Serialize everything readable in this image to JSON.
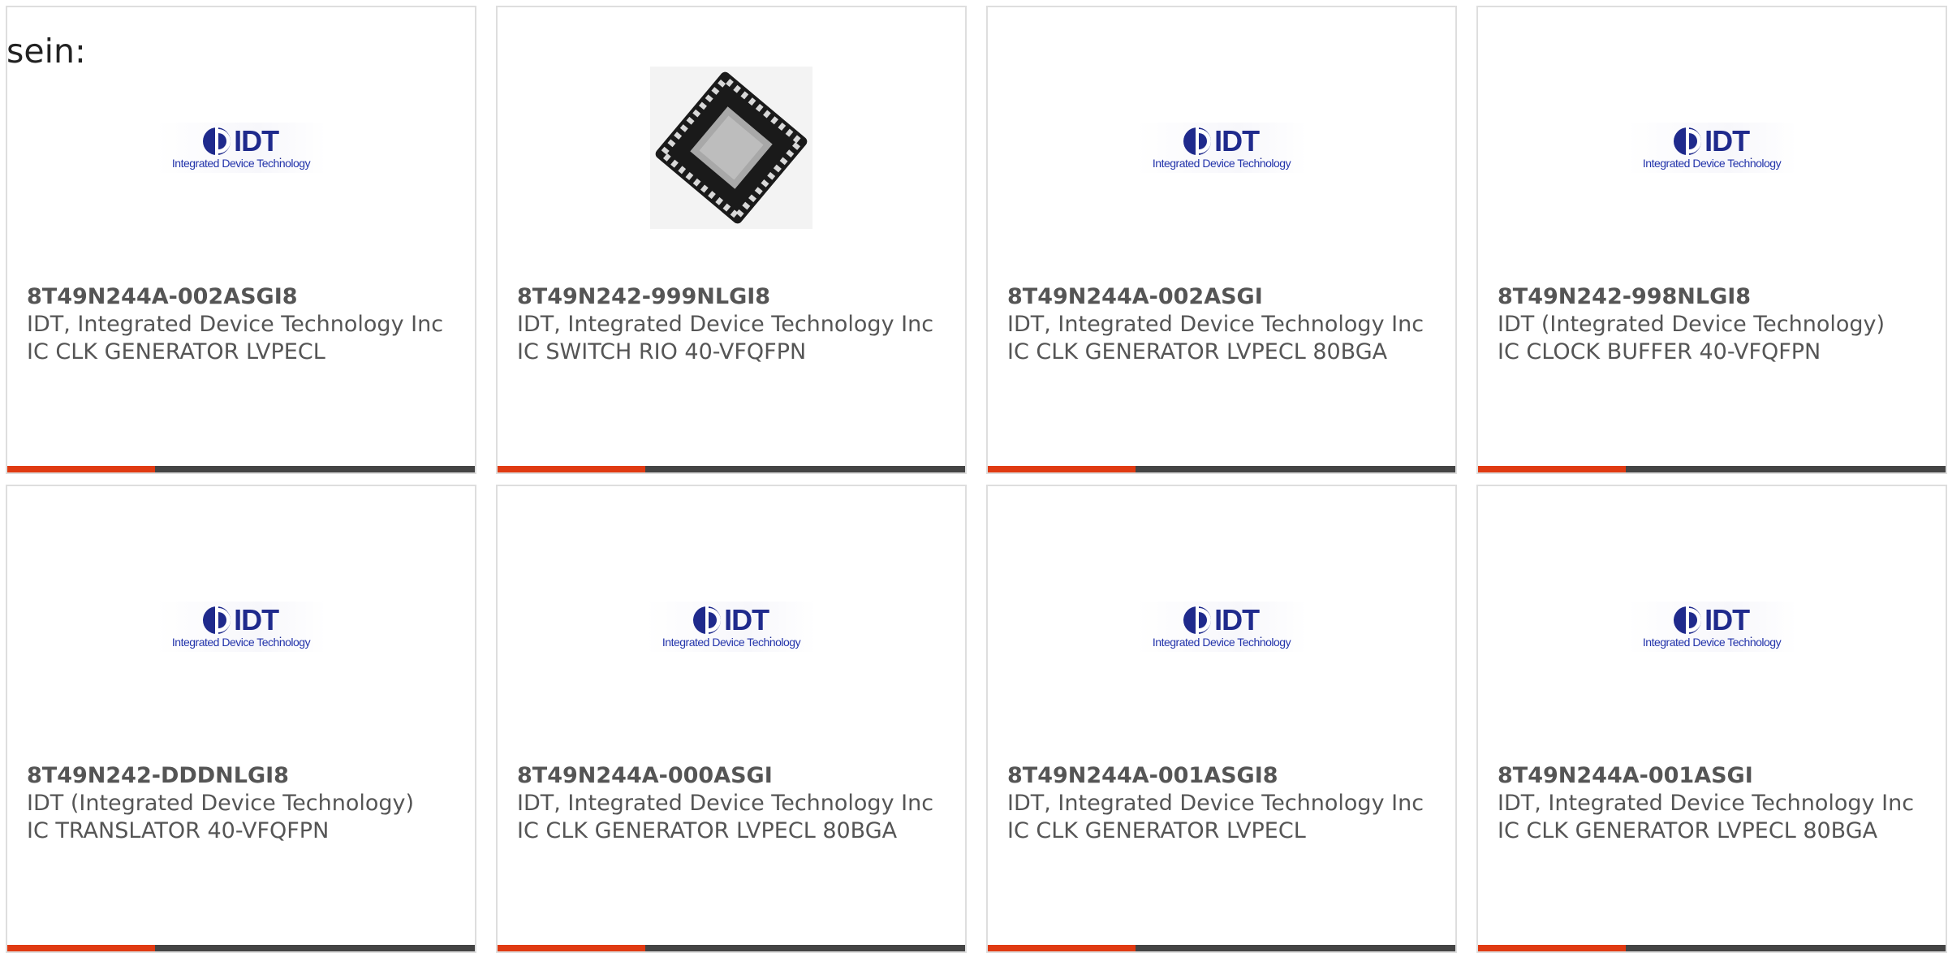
{
  "intro_text": "sein:",
  "theme": {
    "accent_color": "#e03a12",
    "bar_color": "#444444",
    "border_color": "#dedede",
    "logo_color": "#1f2a8c"
  },
  "logo": {
    "wordmark": "IDT",
    "tm": ".",
    "tagline": "Integrated Device Technology"
  },
  "products": [
    {
      "image": "idt-logo",
      "part": "8T49N244A-002ASGI8",
      "maker": "IDT, Integrated Device Technology Inc",
      "desc": "IC CLK GENERATOR LVPECL"
    },
    {
      "image": "chip-photo",
      "part": "8T49N242-999NLGI8",
      "maker": "IDT, Integrated Device Technology Inc",
      "desc": "IC SWITCH RIO 40-VFQFPN"
    },
    {
      "image": "idt-logo",
      "part": "8T49N244A-002ASGI",
      "maker": "IDT, Integrated Device Technology Inc",
      "desc": "IC CLK GENERATOR LVPECL 80BGA"
    },
    {
      "image": "idt-logo",
      "part": "8T49N242-998NLGI8",
      "maker": "IDT (Integrated Device Technology)",
      "desc": "IC CLOCK BUFFER 40-VFQFPN"
    },
    {
      "image": "idt-logo",
      "part": "8T49N242-DDDNLGI8",
      "maker": "IDT (Integrated Device Technology)",
      "desc": "IC TRANSLATOR 40-VFQFPN"
    },
    {
      "image": "idt-logo",
      "part": "8T49N244A-000ASGI",
      "maker": "IDT, Integrated Device Technology Inc",
      "desc": "IC CLK GENERATOR LVPECL 80BGA"
    },
    {
      "image": "idt-logo",
      "part": "8T49N244A-001ASGI8",
      "maker": "IDT, Integrated Device Technology Inc",
      "desc": "IC CLK GENERATOR LVPECL"
    },
    {
      "image": "idt-logo",
      "part": "8T49N244A-001ASGI",
      "maker": "IDT, Integrated Device Technology Inc",
      "desc": "IC CLK GENERATOR LVPECL 80BGA"
    }
  ]
}
